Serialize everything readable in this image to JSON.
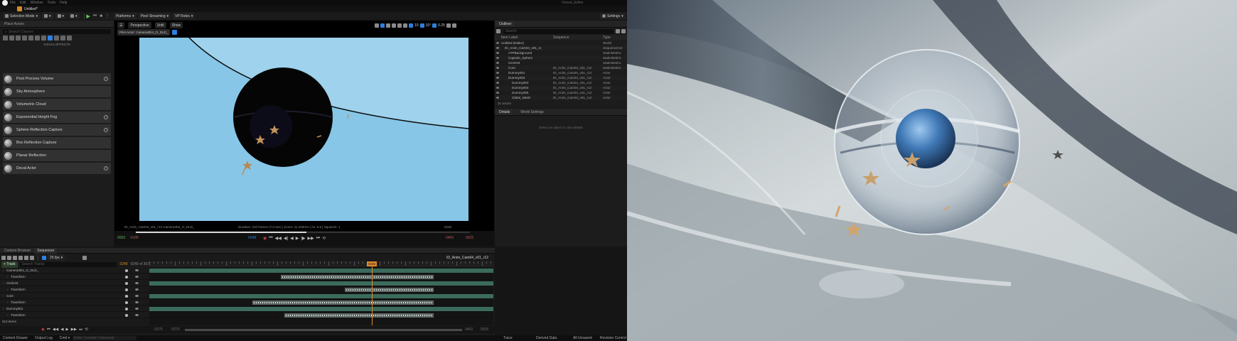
{
  "app": {
    "title": "Untitled*",
    "top_right_title": "Unreal_Editor",
    "settings_label": "Settings"
  },
  "toolbar": {
    "selection_mode": "Selection Mode",
    "platforms": "Platforms",
    "pixel_streaming": "Pixel Streaming",
    "vp_roles": "VP Roles"
  },
  "place_actors": {
    "tabs": [
      "Place Actors"
    ],
    "search_placeholder": "Search Classes",
    "category_label": "VISUAL EFFECTS",
    "items": [
      {
        "label": "Post Process Volume",
        "help": true
      },
      {
        "label": "Sky Atmosphere",
        "help": false
      },
      {
        "label": "Volumetric Cloud",
        "help": false
      },
      {
        "label": "Exponential Height Fog",
        "help": true
      },
      {
        "label": "Sphere Reflection Capture",
        "help": true
      },
      {
        "label": "Box Reflection Capture",
        "help": false
      },
      {
        "label": "Planar Reflection",
        "help": false
      },
      {
        "label": "Decal Actor",
        "help": true
      }
    ]
  },
  "viewport": {
    "perspective": "Perspective",
    "lit": "Unlit",
    "show": "Show",
    "pilot_label": "Pilot Actor: Camera3D4_O_DLD_",
    "bottom_left": "ID_Anim_Cam04_v01_r12 Camera3D4_O_DLD_",
    "bottom_center": "Duration: 210 frames (7.0 sec) | Zoom: 41.230mm | Av: 5.6 | Squeeze: 1",
    "bottom_right": "0248",
    "grid_count": "10",
    "speed": "0.25"
  },
  "playback": {
    "start_frame": "0000",
    "start2": "-0105",
    "current": "0248",
    "end": "0400",
    "end2": "0525",
    "progress": 0.51
  },
  "outliner": {
    "tab": "Outliner",
    "search_placeholder": "Search",
    "columns": [
      "Item Label",
      "Sequence",
      "Type"
    ],
    "rows": [
      {
        "name": "Untitled (Editor)",
        "depth": 0,
        "seq": "",
        "type": "World"
      },
      {
        "name": "ID_Anim_Cam04_v01_r1",
        "depth": 1,
        "seq": "",
        "type": "SequenceAct"
      },
      {
        "name": "ATPBackground",
        "depth": 2,
        "seq": "",
        "type": "StaticMeshA"
      },
      {
        "name": "Capsule_Sphere",
        "depth": 2,
        "seq": "",
        "type": "StaticMeshA"
      },
      {
        "name": "CircleHt",
        "depth": 2,
        "seq": "",
        "type": "StaticMeshA"
      },
      {
        "name": "Core",
        "depth": 2,
        "seq": "ID_Anim_Cam04_v01_r12",
        "type": "StaticMeshA"
      },
      {
        "name": "Dummy001",
        "depth": 2,
        "seq": "ID_Anim_Cam04_v01_r12",
        "type": "Actor"
      },
      {
        "name": "Dummy002",
        "depth": 2,
        "seq": "ID_Anim_Cam04_v01_r12",
        "type": "Actor"
      },
      {
        "name": "Dummy003",
        "depth": 3,
        "seq": "ID_Anim_Cam04_v01_r12",
        "type": "Actor"
      },
      {
        "name": "Dummy004",
        "depth": 3,
        "seq": "ID_Anim_Cam04_v01_r12",
        "type": "Actor"
      },
      {
        "name": "Dummy005",
        "depth": 3,
        "seq": "ID_Anim_Cam04_v01_r12",
        "type": "Actor"
      },
      {
        "name": "Globe_Mesh",
        "depth": 3,
        "seq": "ID_Anim_Cam04_v01_r12",
        "type": "Actor"
      }
    ],
    "count": "31 actors"
  },
  "details": {
    "tab": "Details",
    "world_settings": "World Settings",
    "empty_msg": "Select an object to view details"
  },
  "sequencer": {
    "tabs": [
      "Content Browser",
      "Sequencer"
    ],
    "fps": "25 fps",
    "sequence_name": "ID_Anim_Cam04_v01_r12",
    "track_btn": "+ Track",
    "search_placeholder": "Search Tracks",
    "frame_a": "0248",
    "frame_b": "0249 of 367",
    "playhead_label": "0248",
    "tracks": [
      {
        "name": "Camera3D4_O_DLD_",
        "indent": 0
      },
      {
        "name": "Transform",
        "indent": 1
      },
      {
        "name": "CircleHt",
        "indent": 0
      },
      {
        "name": "Transform",
        "indent": 1
      },
      {
        "name": "Core",
        "indent": 0
      },
      {
        "name": "Transform",
        "indent": 1
      },
      {
        "name": "Dummy001",
        "indent": 0
      },
      {
        "name": "Transform",
        "indent": 1
      }
    ],
    "items_count": "312 items",
    "range_left": "-0275",
    "range_left2": "-0275",
    "range_right": "0400",
    "range_right2": "0525"
  },
  "statusbar": {
    "content_drawer": "Content Drawer",
    "output_log": "Output Log",
    "cmd": "Cmd",
    "cmd_placeholder": "Enter Console Command",
    "trace": "Trace",
    "derived_data": "Derived Data",
    "unsaved": "All Unsaved",
    "revision": "Revision Control"
  },
  "colors": {
    "viewport_sky": "#87c6e6",
    "track_bar": "#3b6b5c",
    "playhead": "#e08a2c",
    "accent_blue": "#2d7fe0"
  }
}
